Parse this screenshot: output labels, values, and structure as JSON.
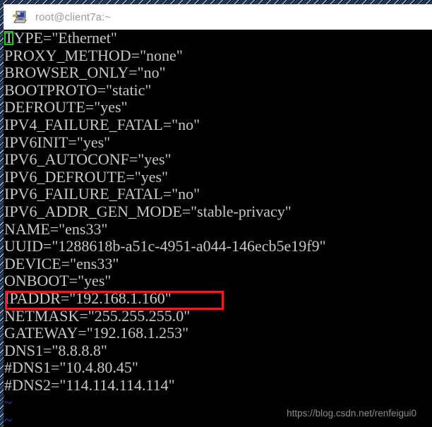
{
  "window": {
    "title": "root@client7a:~",
    "icon": "computer-network-icon"
  },
  "terminal": {
    "editor": "vi",
    "cursor": {
      "line": 0,
      "column": 0,
      "char": "T",
      "color": "#1ecd1e"
    },
    "foreground_color": "#c8c8c8",
    "background_color": "#000000",
    "tilde_color": "#2b39d0",
    "lines": [
      "TYPE=\"Ethernet\"",
      "PROXY_METHOD=\"none\"",
      "BROWSER_ONLY=\"no\"",
      "BOOTPROTO=\"static\"",
      "DEFROUTE=\"yes\"",
      "IPV4_FAILURE_FATAL=\"no\"",
      "IPV6INIT=\"yes\"",
      "IPV6_AUTOCONF=\"yes\"",
      "IPV6_DEFROUTE=\"yes\"",
      "IPV6_FAILURE_FATAL=\"no\"",
      "IPV6_ADDR_GEN_MODE=\"stable-privacy\"",
      "NAME=\"ens33\"",
      "UUID=\"1288618b-a51c-4951-a044-146ecb5e19f9\"",
      "DEVICE=\"ens33\"",
      "ONBOOT=\"yes\"",
      "IPADDR=\"192.168.1.160\"",
      "NETMASK=\"255.255.255.0\"",
      "GATEWAY=\"192.168.1.253\"",
      "DNS1=\"8.8.8.8\"",
      "#DNS1=\"10.4.80.45\"",
      "#DNS2=\"114.114.114.114\"",
      "~",
      "~"
    ]
  },
  "annotation": {
    "highlight_line_index": 15,
    "highlight_color": "#ed1c24",
    "highlighted_text": "IPADDR=\"192.168.1.160\""
  },
  "watermark": {
    "text": "https://blog.csdn.net/renfeigui0"
  }
}
